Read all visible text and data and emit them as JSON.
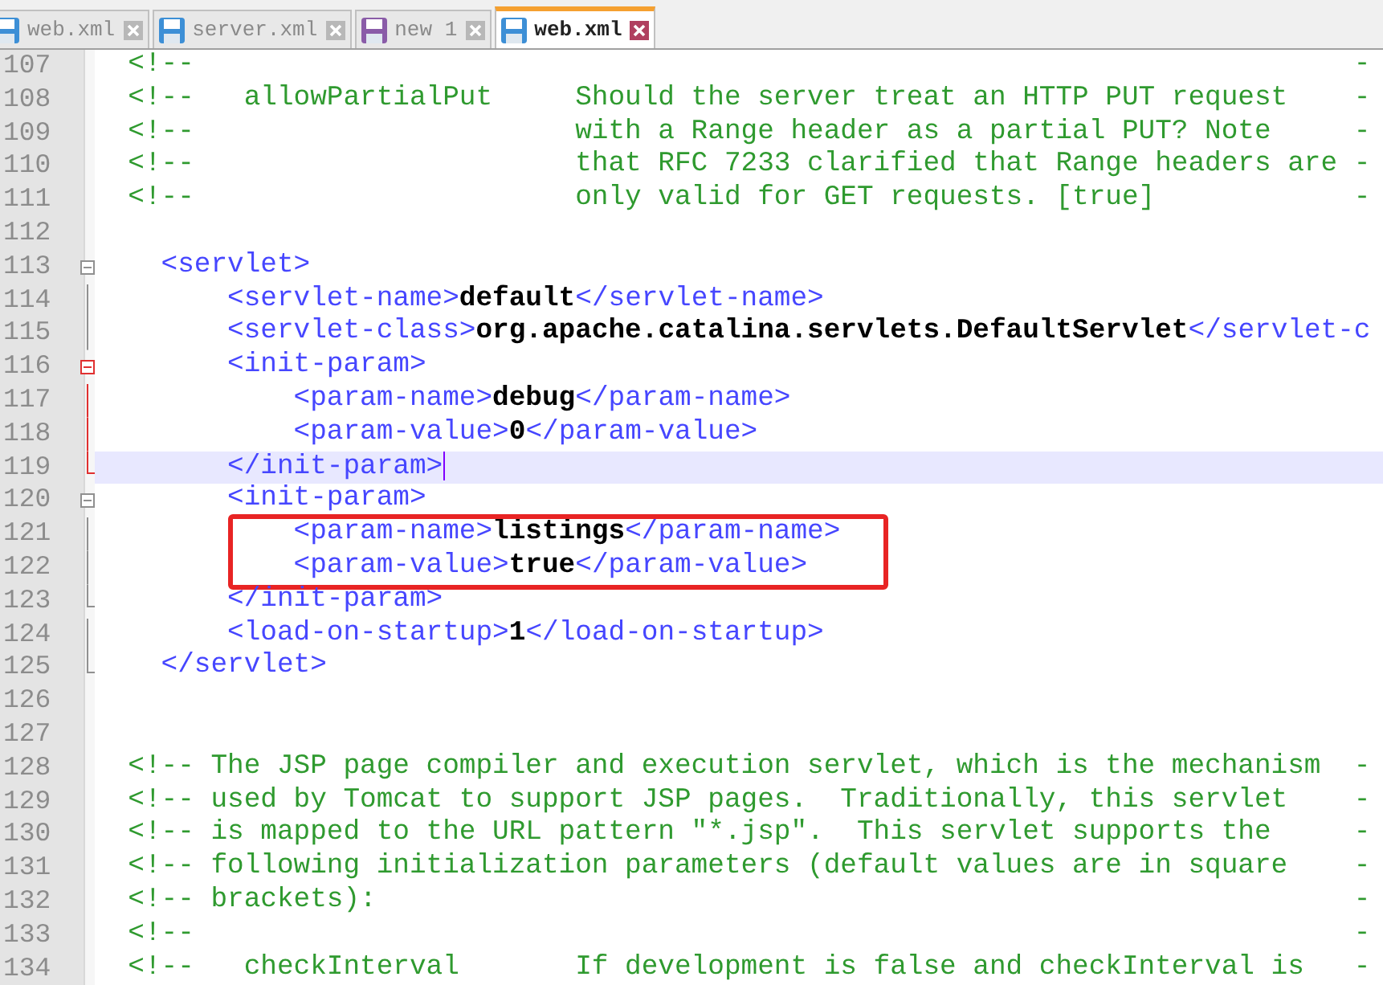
{
  "tabs": [
    {
      "label": "web.xml",
      "selected": false,
      "color": "#3d8fd6"
    },
    {
      "label": "server.xml",
      "selected": false,
      "color": "#3d8fd6"
    },
    {
      "label": "new 1",
      "selected": false,
      "color": "#8a5ca8"
    },
    {
      "label": "web.xml",
      "selected": true,
      "color": "#3d8fd6"
    }
  ],
  "lines": [
    {
      "number": "107",
      "current": false,
      "boxed": false,
      "segments": [
        {
          "kind": "comment",
          "text": "  <!--                                                                      -"
        }
      ]
    },
    {
      "number": "108",
      "current": false,
      "boxed": false,
      "segments": [
        {
          "kind": "comment",
          "text": "  <!--   allowPartialPut     Should the server treat an HTTP PUT request    -"
        }
      ]
    },
    {
      "number": "109",
      "current": false,
      "boxed": false,
      "segments": [
        {
          "kind": "comment",
          "text": "  <!--                       with a Range header as a partial PUT? Note     -"
        }
      ]
    },
    {
      "number": "110",
      "current": false,
      "boxed": false,
      "segments": [
        {
          "kind": "comment",
          "text": "  <!--                       that RFC 7233 clarified that Range headers are -"
        }
      ]
    },
    {
      "number": "111",
      "current": false,
      "boxed": false,
      "segments": [
        {
          "kind": "comment",
          "text": "  <!--                       only valid for GET requests. [true]            -"
        }
      ]
    },
    {
      "number": "112",
      "current": false,
      "boxed": false
    },
    {
      "number": "113",
      "fold": {
        "kind": "toggle",
        "active": false
      },
      "current": false,
      "boxed": false,
      "segments": [
        {
          "kind": "tag",
          "text": "    <servlet>"
        }
      ]
    },
    {
      "number": "114",
      "fold": {
        "kind": "line",
        "active": false
      },
      "current": false,
      "boxed": false,
      "segments": [
        {
          "kind": "tag",
          "text": "        <servlet-name>"
        },
        {
          "kind": "value",
          "text": "default"
        },
        {
          "kind": "tag",
          "text": "</servlet-name>"
        }
      ]
    },
    {
      "number": "115",
      "fold": {
        "kind": "line",
        "active": false
      },
      "current": false,
      "boxed": false,
      "segments": [
        {
          "kind": "tag",
          "text": "        <servlet-class>"
        },
        {
          "kind": "value",
          "text": "org.apache.catalina.servlets.DefaultServlet"
        },
        {
          "kind": "tag",
          "text": "</servlet-c"
        }
      ]
    },
    {
      "number": "116",
      "fold": {
        "kind": "toggle",
        "active": true
      },
      "current": false,
      "boxed": false,
      "segments": [
        {
          "kind": "tag",
          "text": "        <init-param>"
        }
      ]
    },
    {
      "number": "117",
      "fold": {
        "kind": "line",
        "active": true
      },
      "current": false,
      "boxed": false,
      "segments": [
        {
          "kind": "tag",
          "text": "            <param-name>"
        },
        {
          "kind": "value",
          "text": "debug"
        },
        {
          "kind": "tag",
          "text": "</param-name>"
        }
      ]
    },
    {
      "number": "118",
      "fold": {
        "kind": "line",
        "active": true
      },
      "current": false,
      "boxed": false,
      "segments": [
        {
          "kind": "tag",
          "text": "            <param-value>"
        },
        {
          "kind": "value",
          "text": "0"
        },
        {
          "kind": "tag",
          "text": "</param-value>"
        }
      ]
    },
    {
      "number": "119",
      "fold": {
        "kind": "end",
        "active": true
      },
      "current": true,
      "boxed": false,
      "segments": [
        {
          "kind": "tag",
          "text": "        </init-param>"
        }
      ]
    },
    {
      "number": "120",
      "fold": {
        "kind": "toggle",
        "active": false
      },
      "current": false,
      "boxed": false,
      "segments": [
        {
          "kind": "tag",
          "text": "        <init-param>"
        }
      ]
    },
    {
      "number": "121",
      "fold": {
        "kind": "line",
        "active": false
      },
      "current": false,
      "boxed": true,
      "segments": [
        {
          "kind": "tag",
          "text": "            <param-name>"
        },
        {
          "kind": "value",
          "text": "listings"
        },
        {
          "kind": "tag",
          "text": "</param-name>"
        }
      ]
    },
    {
      "number": "122",
      "fold": {
        "kind": "line",
        "active": false
      },
      "current": false,
      "boxed": true,
      "segments": [
        {
          "kind": "tag",
          "text": "            <param-value>"
        },
        {
          "kind": "value",
          "text": "true"
        },
        {
          "kind": "tag",
          "text": "</param-value>"
        }
      ]
    },
    {
      "number": "123",
      "fold": {
        "kind": "end",
        "active": false
      },
      "current": false,
      "boxed": false,
      "segments": [
        {
          "kind": "tag",
          "text": "        </init-param>"
        }
      ]
    },
    {
      "number": "124",
      "fold": {
        "kind": "line",
        "active": false
      },
      "current": false,
      "boxed": false,
      "segments": [
        {
          "kind": "tag",
          "text": "        <load-on-startup>"
        },
        {
          "kind": "value",
          "text": "1"
        },
        {
          "kind": "tag",
          "text": "</load-on-startup>"
        }
      ]
    },
    {
      "number": "125",
      "fold": {
        "kind": "end",
        "active": false
      },
      "current": false,
      "boxed": false,
      "segments": [
        {
          "kind": "tag",
          "text": "    </servlet>"
        }
      ]
    },
    {
      "number": "126",
      "current": false,
      "boxed": false
    },
    {
      "number": "127",
      "current": false,
      "boxed": false
    },
    {
      "number": "128",
      "current": false,
      "boxed": false,
      "segments": [
        {
          "kind": "comment",
          "text": "  <!-- The JSP page compiler and execution servlet, which is the mechanism  -"
        }
      ]
    },
    {
      "number": "129",
      "current": false,
      "boxed": false,
      "segments": [
        {
          "kind": "comment",
          "text": "  <!-- used by Tomcat to support JSP pages.  Traditionally, this servlet    -"
        }
      ]
    },
    {
      "number": "130",
      "current": false,
      "boxed": false,
      "segments": [
        {
          "kind": "comment",
          "text": "  <!-- is mapped to the URL pattern \"*.jsp\".  This servlet supports the     -"
        }
      ]
    },
    {
      "number": "131",
      "current": false,
      "boxed": false,
      "segments": [
        {
          "kind": "comment",
          "text": "  <!-- following initialization parameters (default values are in square    -"
        }
      ]
    },
    {
      "number": "132",
      "current": false,
      "boxed": false,
      "segments": [
        {
          "kind": "comment",
          "text": "  <!-- brackets):                                                           -"
        }
      ]
    },
    {
      "number": "133",
      "current": false,
      "boxed": false,
      "segments": [
        {
          "kind": "comment",
          "text": "  <!--                                                                      -"
        }
      ]
    },
    {
      "number": "134",
      "current": false,
      "boxed": false,
      "segments": [
        {
          "kind": "comment",
          "text": "  <!--   checkInterval       If development is false and checkInterval is   -"
        }
      ]
    }
  ]
}
